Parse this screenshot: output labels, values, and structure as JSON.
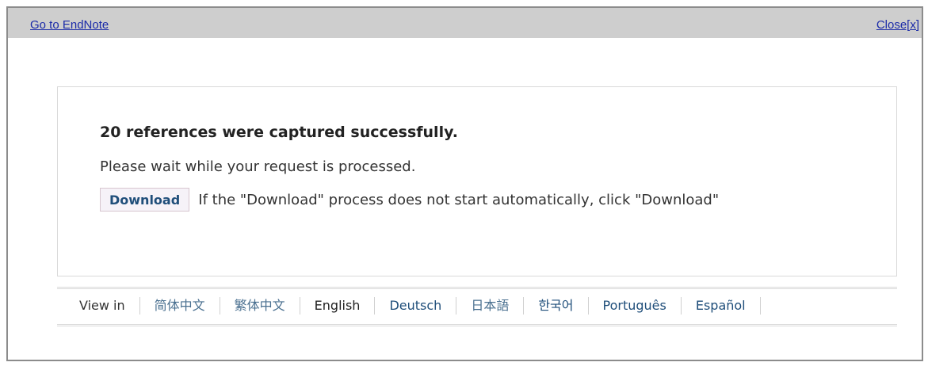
{
  "topbar": {
    "go_link": "Go to EndNote",
    "close_link": "Close[x]"
  },
  "message": {
    "headline": "20 references were captured successfully.",
    "wait_text": "Please wait while your request is processed.",
    "download_button": "Download",
    "download_hint": "If the \"Download\" process does not start automatically, click \"Download\""
  },
  "languages": {
    "view_in": "View in",
    "items": [
      "简体中文",
      "繁体中文",
      "English",
      "Deutsch",
      "日本語",
      "한국어",
      "Português",
      "Español"
    ],
    "selected": "English"
  }
}
